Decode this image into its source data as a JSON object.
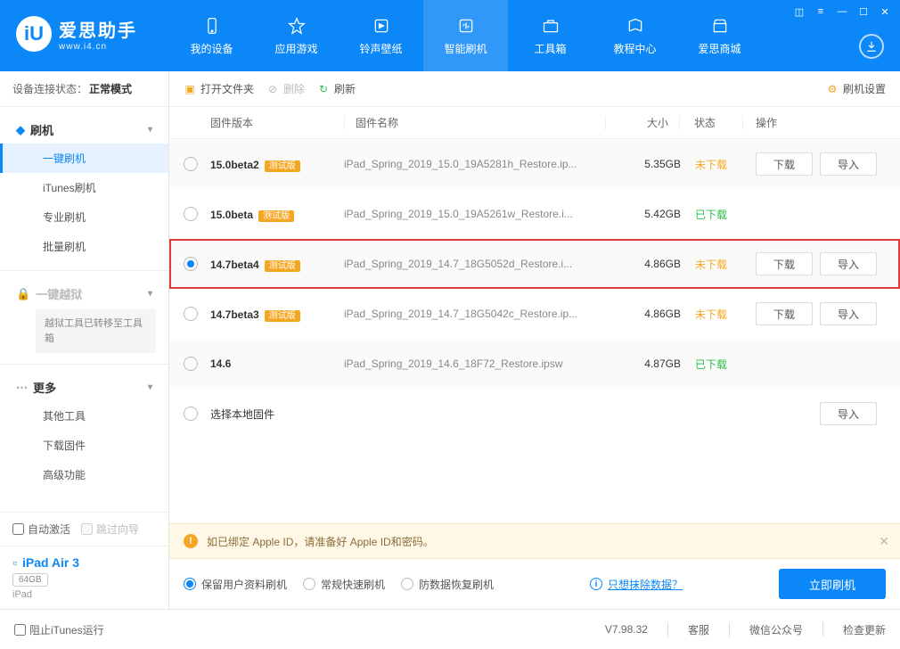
{
  "brand": {
    "zh": "爱思助手",
    "en": "www.i4.cn"
  },
  "nav": [
    {
      "label": "我的设备"
    },
    {
      "label": "应用游戏"
    },
    {
      "label": "铃声壁纸"
    },
    {
      "label": "智能刷机"
    },
    {
      "label": "工具箱"
    },
    {
      "label": "教程中心"
    },
    {
      "label": "爱思商城"
    }
  ],
  "conn": {
    "prefix": "设备连接状态：",
    "mode": "正常模式"
  },
  "side": {
    "flash": {
      "title": "刷机",
      "items": [
        "一键刷机",
        "iTunes刷机",
        "专业刷机",
        "批量刷机"
      ]
    },
    "jailbreak": {
      "title": "一键越狱",
      "note": "越狱工具已转移至工具箱"
    },
    "more": {
      "title": "更多",
      "items": [
        "其他工具",
        "下载固件",
        "高级功能"
      ]
    }
  },
  "auto_activate": "自动激活",
  "skip_guide": "跳过向导",
  "device": {
    "name": "iPad Air 3",
    "storage": "64GB",
    "type": "iPad"
  },
  "toolbar": {
    "open": "打开文件夹",
    "delete": "删除",
    "refresh": "刷新",
    "settings": "刷机设置"
  },
  "columns": {
    "ver": "固件版本",
    "name": "固件名称",
    "size": "大小",
    "status": "状态",
    "ops": "操作"
  },
  "rows": [
    {
      "ver": "15.0beta2",
      "badge": "测试版",
      "name": "iPad_Spring_2019_15.0_19A5281h_Restore.ip...",
      "size": "5.35GB",
      "status": "未下载",
      "status_cls": "no",
      "dl": true,
      "imp": true,
      "alt": true,
      "sel": false
    },
    {
      "ver": "15.0beta",
      "badge": "测试版",
      "name": "iPad_Spring_2019_15.0_19A5261w_Restore.i...",
      "size": "5.42GB",
      "status": "已下载",
      "status_cls": "yes",
      "dl": false,
      "imp": false,
      "alt": false,
      "sel": false
    },
    {
      "ver": "14.7beta4",
      "badge": "测试版",
      "name": "iPad_Spring_2019_14.7_18G5052d_Restore.i...",
      "size": "4.86GB",
      "status": "未下载",
      "status_cls": "no",
      "dl": true,
      "imp": true,
      "alt": true,
      "sel": true,
      "highlight": true
    },
    {
      "ver": "14.7beta3",
      "badge": "测试版",
      "name": "iPad_Spring_2019_14.7_18G5042c_Restore.ip...",
      "size": "4.86GB",
      "status": "未下载",
      "status_cls": "no",
      "dl": true,
      "imp": true,
      "alt": false,
      "sel": false
    },
    {
      "ver": "14.6",
      "badge": "",
      "name": "iPad_Spring_2019_14.6_18F72_Restore.ipsw",
      "size": "4.87GB",
      "status": "已下载",
      "status_cls": "yes",
      "dl": false,
      "imp": false,
      "alt": true,
      "sel": false
    }
  ],
  "local_row": "选择本地固件",
  "btn": {
    "download": "下载",
    "import": "导入"
  },
  "warning": "如已绑定 Apple ID，请准备好 Apple ID和密码。",
  "flash_opts": [
    "保留用户资料刷机",
    "常规快速刷机",
    "防数据恢复刷机"
  ],
  "erase_link": "只想抹除数据？",
  "flash_btn": "立即刷机",
  "status": {
    "block_itunes": "阻止iTunes运行",
    "version": "V7.98.32",
    "service": "客服",
    "wechat": "微信公众号",
    "update": "检查更新"
  }
}
